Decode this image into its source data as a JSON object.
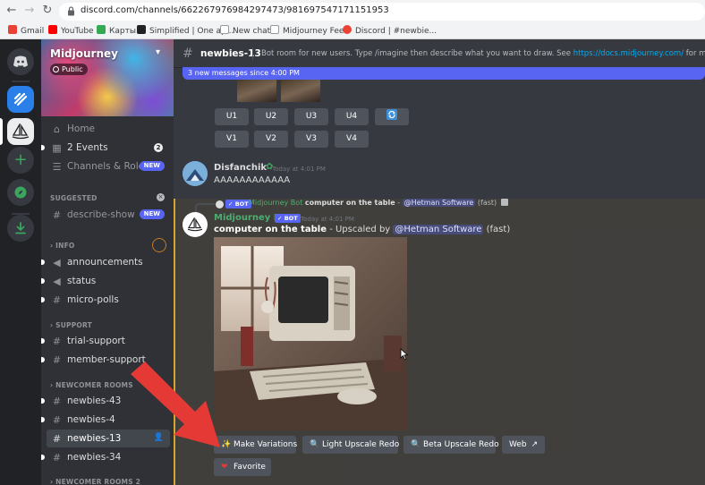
{
  "browser": {
    "url": "discord.com/channels/662267976984297473/981697547171151953",
    "bookmarks": [
      "Gmail",
      "YouTube",
      "Карты",
      "Simplified | One ap...",
      "New chat",
      "Midjourney Feed",
      "Discord | #newbie..."
    ]
  },
  "server": {
    "name": "Midjourney",
    "public_label": "Public"
  },
  "sidebar": {
    "top_items": [
      {
        "label": "Home",
        "icon": "home-icon"
      },
      {
        "label": "2 Events",
        "icon": "calendar-icon",
        "count": "2"
      },
      {
        "label": "Channels & Roles",
        "icon": "channels-roles-icon",
        "badge": "NEW"
      }
    ],
    "suggested_label": "SUGGESTED",
    "suggested_items": [
      {
        "label": "describe-show",
        "badge": "NEW"
      }
    ],
    "categories": [
      {
        "label": "INFO",
        "items": [
          "announcements",
          "status",
          "micro-polls"
        ]
      },
      {
        "label": "SUPPORT",
        "items": [
          "trial-support",
          "member-support"
        ]
      },
      {
        "label": "NEWCOMER ROOMS",
        "items": [
          "newbies-43",
          "newbies-4",
          "newbies-13",
          "newbies-34"
        ]
      },
      {
        "label": "NEWCOMER ROOMS 2",
        "items": []
      }
    ]
  },
  "channel": {
    "name": "newbies-13",
    "topic_prefix": "Bot room for new users. Type /imagine then describe what you want to draw. See ",
    "topic_link": "https://docs.midjourney.com/",
    "topic_suffix": " for more information"
  },
  "new_messages_banner": "3 new messages since 4:00 PM",
  "grid_buttons": {
    "upscale": [
      "U1",
      "U2",
      "U3",
      "U4"
    ],
    "variation": [
      "V1",
      "V2",
      "V3",
      "V4"
    ]
  },
  "messages": [
    {
      "author": "Disfanchik",
      "timestamp": "Today at 4:01 PM",
      "text": "AAAAAAAAAAAA",
      "color": "#dcddde"
    },
    {
      "reply": {
        "author": "Midjourney Bot",
        "bot_tag": "✓ BOT",
        "prompt": "computer on the table",
        "mention": "@Hetman Software",
        "suffix": "(fast)"
      },
      "author": "Midjourney Bot",
      "bot_tag": "✓ BOT",
      "timestamp": "Today at 4:01 PM",
      "prompt": "computer on the table",
      "text_middle": " - Upscaled by ",
      "mention": "@Hetman Software",
      "suffix": " (fast)",
      "color": "#4bae6f"
    }
  ],
  "reply_separator": " - ",
  "components": {
    "make_variations": "Make Variations",
    "light_upscale_redo": "Light Upscale Redo",
    "beta_upscale_redo": "Beta Upscale Redo",
    "web": "Web",
    "favorite": "Favorite"
  },
  "colors": {
    "blurple": "#5865f2",
    "bot_name": "#4bae6f",
    "highlight": "#d4a72c",
    "arrow": "#e53935"
  }
}
